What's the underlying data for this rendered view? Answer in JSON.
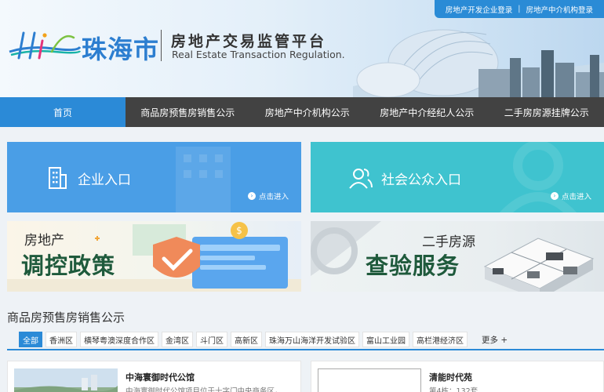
{
  "header": {
    "city_name": "珠海市",
    "title_cn": "房地产交易监管平台",
    "title_en": "Real Estate Transaction Regulation.",
    "login_links": [
      "房地产开发企业登录",
      "房地产中介机构登录"
    ],
    "login_separator": "|"
  },
  "nav": {
    "items": [
      "首页",
      "商品房预售房销售公示",
      "房地产中介机构公示",
      "房地产中介经纪人公示",
      "二手房房源挂牌公示"
    ]
  },
  "entries": {
    "enterprise": {
      "label": "企业入口",
      "enter": "点击进入",
      "icon": "building-icon"
    },
    "public": {
      "label": "社会公众入口",
      "enter": "点击进入",
      "icon": "users-icon"
    }
  },
  "banners": {
    "policy": {
      "small": "房地产",
      "big": "调控政策"
    },
    "inspection": {
      "small": "二手房源",
      "big": "查验服务"
    }
  },
  "section": {
    "title": "商品房预售房销售公示",
    "filters": [
      "全部",
      "香洲区",
      "横琴粤澳深度合作区",
      "金湾区",
      "斗门区",
      "高新区",
      "珠海万山海洋开发试验区",
      "富山工业园",
      "高栏港经济区"
    ],
    "more": "更多 +"
  },
  "listings": [
    {
      "title": "中海寰御时代公馆",
      "desc": "中海寰御时代公馆项目位于十字门中央商务区，..."
    },
    {
      "title": "清能时代苑",
      "desc": "第4栋：132套"
    }
  ],
  "colors": {
    "primary": "#2b8ad7",
    "nav_bg": "#424242",
    "entry_blue": "#4a9ee6",
    "entry_teal": "#3fc3cf"
  }
}
